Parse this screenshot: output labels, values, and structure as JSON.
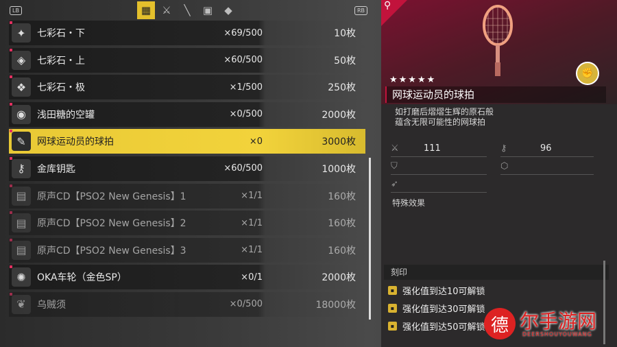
{
  "topbar": {
    "lb_label": "LB",
    "rb_label": "RB",
    "tabs": [
      {
        "icon": "grid-icon",
        "glyph": "▦",
        "active": true
      },
      {
        "icon": "sword-icon",
        "glyph": "⚔",
        "active": false
      },
      {
        "icon": "blade-icon",
        "glyph": "╲",
        "active": false
      },
      {
        "icon": "box-icon",
        "glyph": "▣",
        "active": false
      },
      {
        "icon": "diamond-icon",
        "glyph": "◆",
        "active": false
      }
    ]
  },
  "items": [
    {
      "name": "七彩石・下",
      "qty": "×69/500",
      "price": "10枚",
      "glyph": "✦",
      "dim": false,
      "sel": false
    },
    {
      "name": "七彩石・上",
      "qty": "×60/500",
      "price": "50枚",
      "glyph": "◈",
      "dim": false,
      "sel": false
    },
    {
      "name": "七彩石・极",
      "qty": "×1/500",
      "price": "250枚",
      "glyph": "❖",
      "dim": false,
      "sel": false
    },
    {
      "name": "浅田糖的空罐",
      "qty": "×0/500",
      "price": "2000枚",
      "glyph": "◉",
      "dim": false,
      "sel": false
    },
    {
      "name": "网球运动员的球拍",
      "qty": "×0",
      "price": "3000枚",
      "glyph": "✎",
      "dim": false,
      "sel": true
    },
    {
      "name": "金库钥匙",
      "qty": "×60/500",
      "price": "1000枚",
      "glyph": "⚷",
      "dim": false,
      "sel": false
    },
    {
      "name": "原声CD【PSO2 New Genesis】1",
      "qty": "×1/1",
      "price": "160枚",
      "glyph": "▤",
      "dim": true,
      "sel": false
    },
    {
      "name": "原声CD【PSO2 New Genesis】2",
      "qty": "×1/1",
      "price": "160枚",
      "glyph": "▤",
      "dim": true,
      "sel": false
    },
    {
      "name": "原声CD【PSO2 New Genesis】3",
      "qty": "×1/1",
      "price": "160枚",
      "glyph": "▤",
      "dim": true,
      "sel": false
    },
    {
      "name": "OKA车轮（金色SP）",
      "qty": "×0/1",
      "price": "2000枚",
      "glyph": "✺",
      "dim": false,
      "sel": false
    },
    {
      "name": "乌贼须",
      "qty": "×0/500",
      "price": "18000枚",
      "glyph": "❦",
      "dim": true,
      "sel": false
    }
  ],
  "detail": {
    "stars": "★★★★★",
    "title": "网球运动员的球拍",
    "desc": "如打磨后熠熠生辉的原石般\n蕴含无限可能性的网球拍",
    "attack": "111",
    "skill": "96",
    "special_label": "特殊效果",
    "engrave_label": "刻印",
    "engrave": [
      "强化值到达10可解锁",
      "强化值到达30可解锁",
      "强化值到达50可解锁"
    ]
  },
  "watermark": {
    "badge": "德",
    "title": "尔手游网",
    "sub": "DEERSHOUYOUWANG"
  }
}
